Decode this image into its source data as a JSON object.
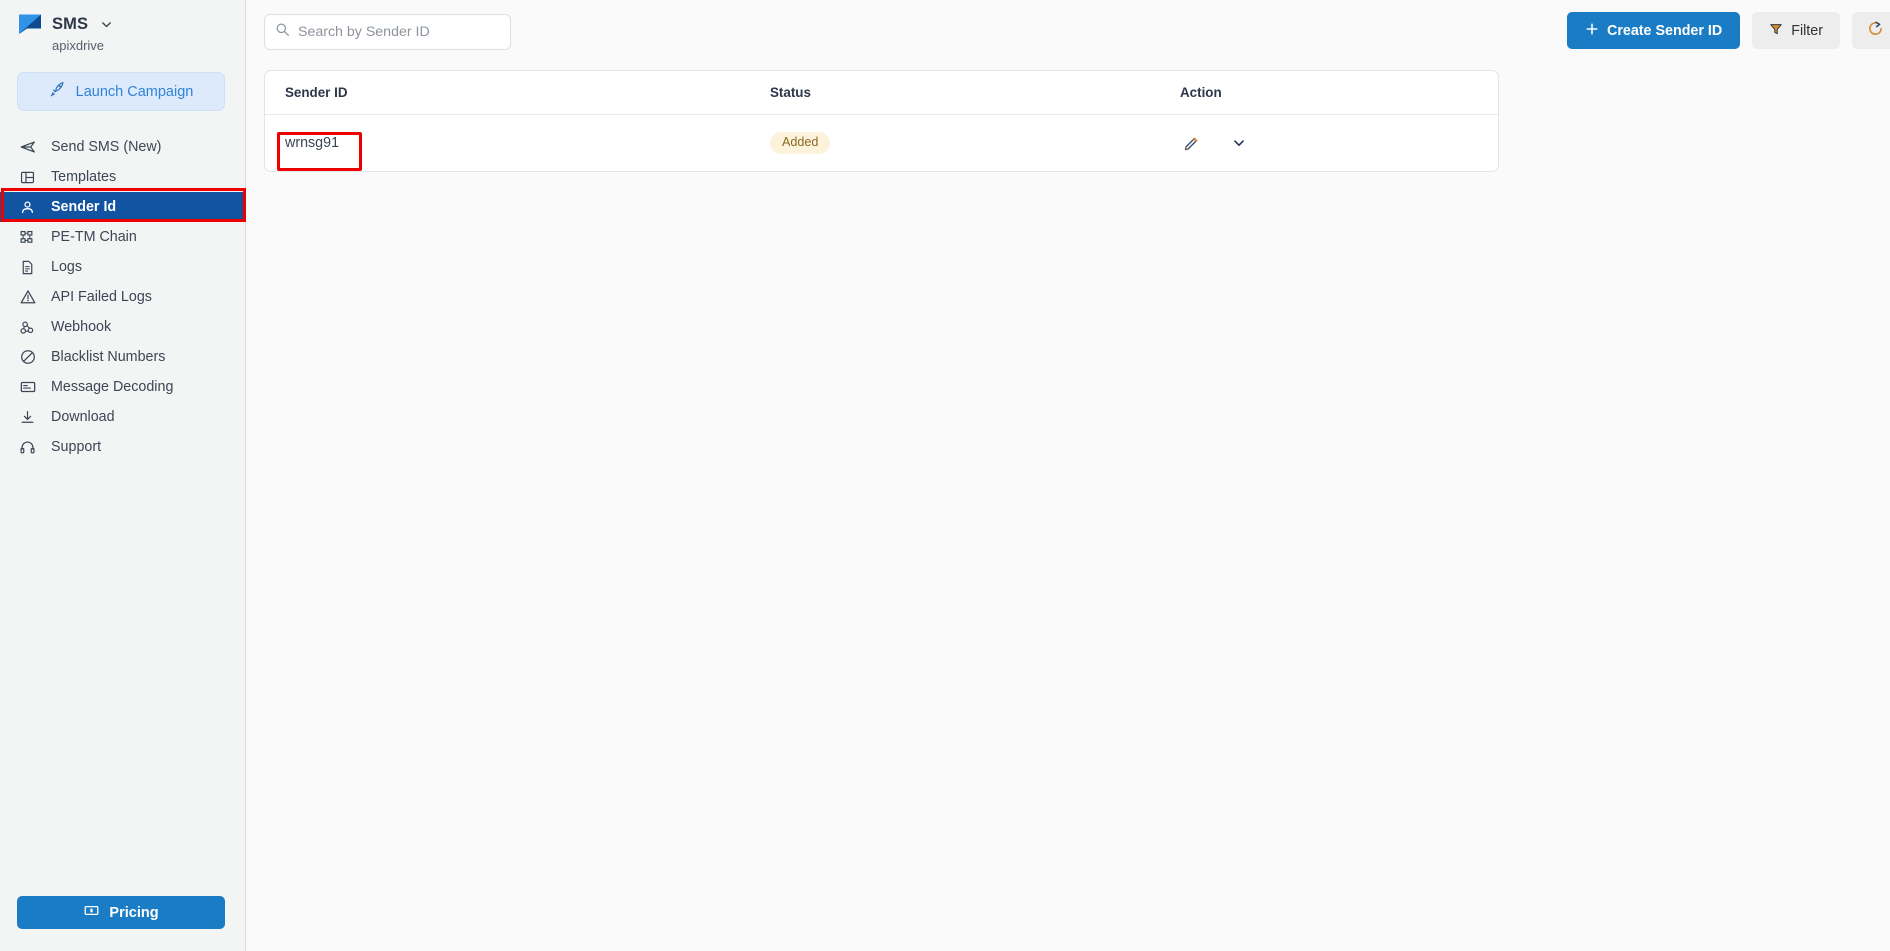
{
  "brand": {
    "name": "SMS",
    "subtitle": "apixdrive",
    "logo_icon": "chat-bubble-logo",
    "chevron_icon": "chevron-down-icon",
    "accent_color": "#1a7cc4"
  },
  "sidebar": {
    "launch_button": {
      "label": "Launch Campaign",
      "icon": "rocket-icon"
    },
    "items": [
      {
        "label": "Send SMS (New)",
        "icon": "send-icon",
        "active": false
      },
      {
        "label": "Templates",
        "icon": "template-grid-icon",
        "active": false
      },
      {
        "label": "Sender Id",
        "icon": "user-icon",
        "active": true
      },
      {
        "label": "PE-TM Chain",
        "icon": "sitemap-icon",
        "active": false
      },
      {
        "label": "Logs",
        "icon": "document-icon",
        "active": false
      },
      {
        "label": "API Failed Logs",
        "icon": "warning-triangle-icon",
        "active": false
      },
      {
        "label": "Webhook",
        "icon": "webhook-icon",
        "active": false
      },
      {
        "label": "Blacklist Numbers",
        "icon": "block-circle-icon",
        "active": false
      },
      {
        "label": "Message Decoding",
        "icon": "message-box-icon",
        "active": false
      },
      {
        "label": "Download",
        "icon": "download-icon",
        "active": false
      },
      {
        "label": "Support",
        "icon": "headset-icon",
        "active": false
      }
    ],
    "pricing_button": {
      "label": "Pricing",
      "icon": "money-note-icon"
    }
  },
  "toolbar": {
    "search": {
      "value": "",
      "placeholder": "Search by Sender ID",
      "icon": "search-icon"
    },
    "create_button": {
      "label": "Create Sender ID",
      "icon": "plus-icon"
    },
    "filter_button": {
      "label": "Filter",
      "icon": "filter-funnel-icon"
    },
    "refresh_button": {
      "label": "",
      "icon": "refresh-icon"
    }
  },
  "table": {
    "columns": [
      "Sender ID",
      "Status",
      "Action"
    ],
    "rows": [
      {
        "sender_id": "wrnsg91",
        "status": "Added",
        "actions": [
          "edit-pencil-icon",
          "chevron-down-icon"
        ]
      }
    ]
  },
  "annotations": {
    "highlight_color": "#ef0000",
    "boxes": [
      "sidebar-item-sender-id",
      "table-cell-sender-id"
    ]
  }
}
